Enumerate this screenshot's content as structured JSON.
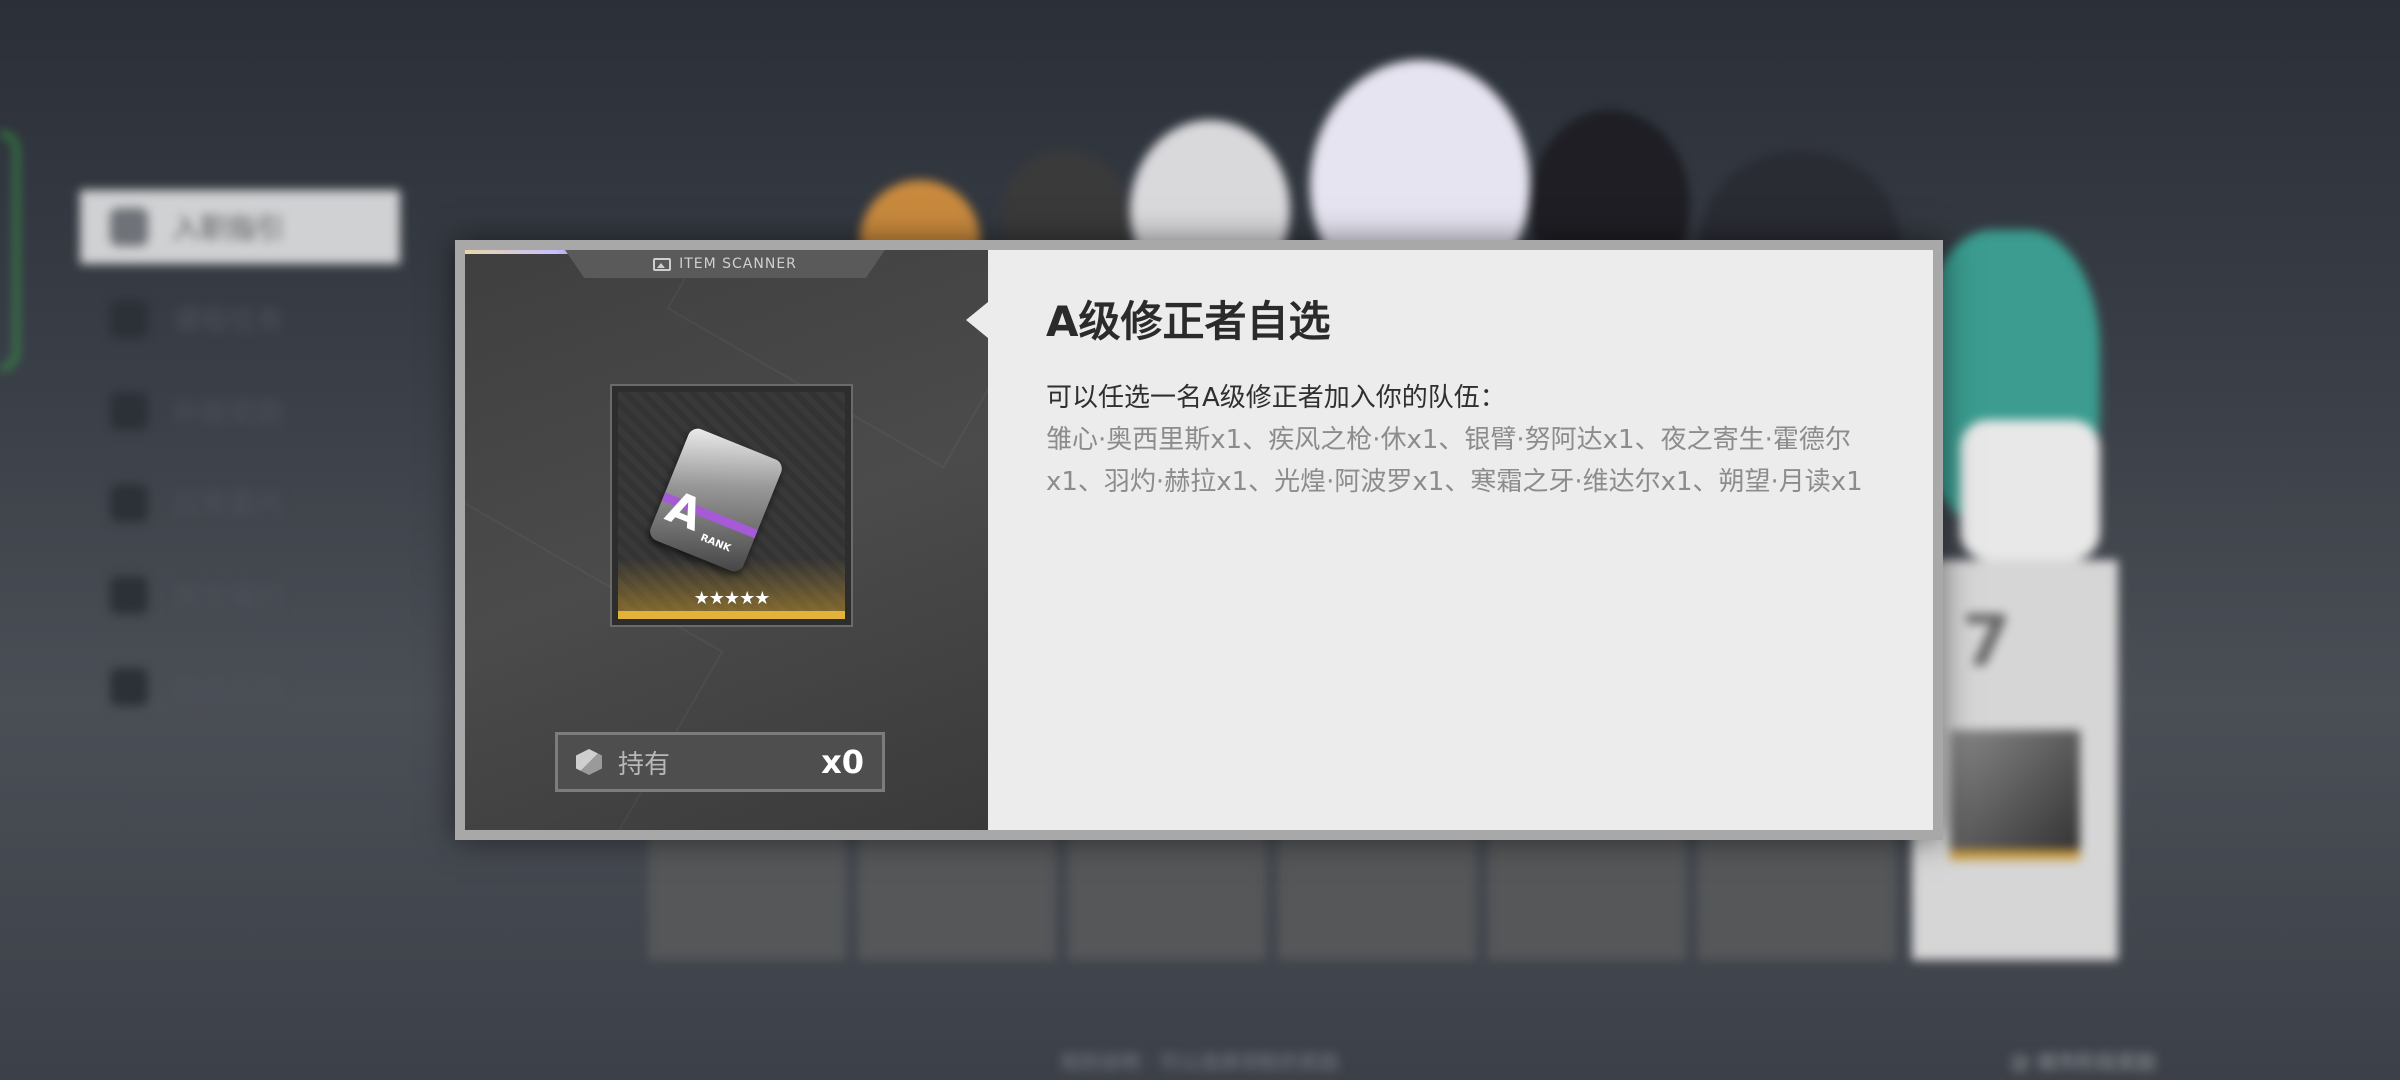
{
  "background": {
    "menu_items": [
      "入职指引",
      "课程任务",
      "升级奖励",
      "日常委托",
      "首充福利",
      "典藏蓝图"
    ],
    "card_number": "7",
    "footer_text": "规则说明 · 可以选择领取的奖励",
    "footer_right": "@ 城市阶段奖励"
  },
  "modal": {
    "scanner_label": "ITEM SCANNER",
    "item_rank_letter": "A",
    "item_rank_text": "RANK",
    "item_stars": "★★★★★",
    "star_count": 5,
    "hold_label": "持有",
    "hold_count": "x0",
    "title": "A级修正者自选",
    "description": "可以任选一名A级修正者加入你的队伍：",
    "list_text": "雏心·奥西里斯x1、疾风之枪·休x1、银臂·努阿达x1、夜之寄生·霍德尔x1、羽灼·赫拉x1、光煌·阿波罗x1、寒霜之牙·维达尔x1、朔望·月读x1"
  },
  "colors": {
    "accent_green": "#35c24a",
    "rarity_gold": "#e2b23b",
    "rank_purple": "#a65ad6"
  }
}
